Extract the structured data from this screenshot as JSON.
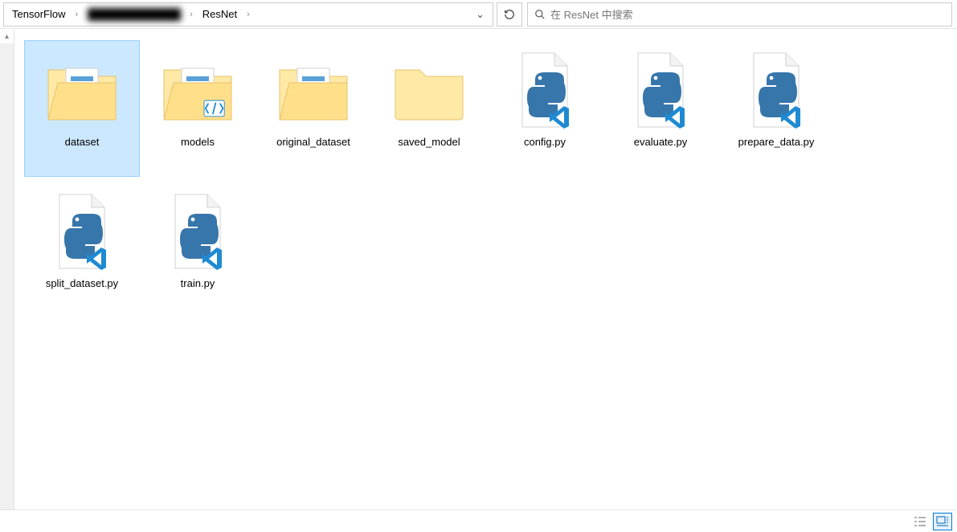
{
  "breadcrumb": {
    "items": [
      "TensorFlow",
      "██████████████",
      "ResNet"
    ],
    "blurred_index": 1
  },
  "search": {
    "placeholder": "在 ResNet 中搜索"
  },
  "items": [
    {
      "name": "dataset",
      "type": "folder-doc",
      "selected": true
    },
    {
      "name": "models",
      "type": "folder-code",
      "selected": false
    },
    {
      "name": "original_dataset",
      "type": "folder-doc",
      "selected": false
    },
    {
      "name": "saved_model",
      "type": "folder-plain",
      "selected": false
    },
    {
      "name": "config.py",
      "type": "py-file",
      "selected": false
    },
    {
      "name": "evaluate.py",
      "type": "py-file",
      "selected": false
    },
    {
      "name": "prepare_data.py",
      "type": "py-file",
      "selected": false
    },
    {
      "name": "split_dataset.py",
      "type": "py-file",
      "selected": false
    },
    {
      "name": "train.py",
      "type": "py-file",
      "selected": false
    }
  ],
  "view": {
    "active": "large-icons"
  }
}
